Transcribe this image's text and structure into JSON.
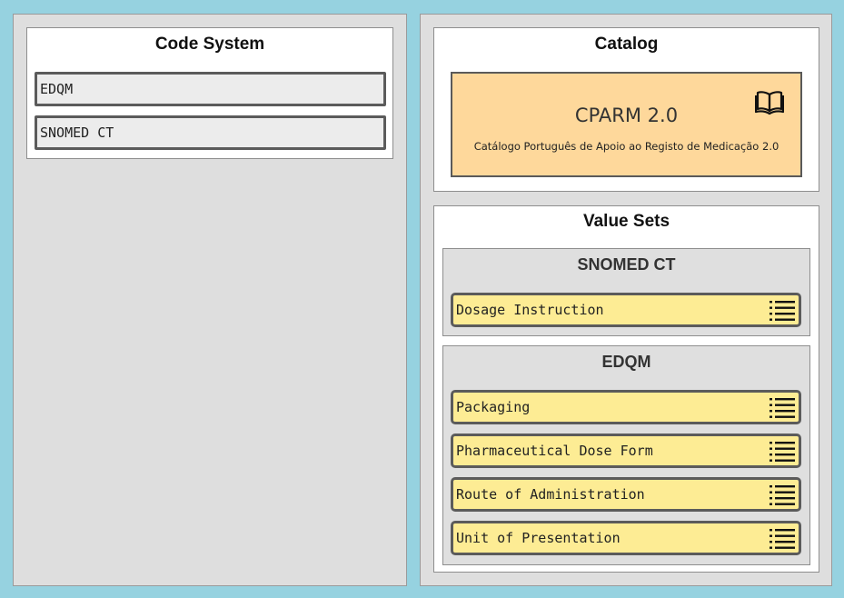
{
  "code_system": {
    "title": "Code System",
    "items": [
      {
        "label": "EDQM"
      },
      {
        "label": "SNOMED CT"
      }
    ]
  },
  "catalog": {
    "title": "Catalog",
    "name": "CPARM 2.0",
    "description": "Catálogo Português de Apoio ao Registo de Medicação 2.0",
    "icon": "book-icon"
  },
  "value_sets": {
    "title": "Value Sets",
    "groups": [
      {
        "title": "SNOMED CT",
        "items": [
          {
            "label": "Dosage Instruction",
            "icon": "list-icon"
          }
        ]
      },
      {
        "title": "EDQM",
        "items": [
          {
            "label": "Packaging",
            "icon": "list-icon"
          },
          {
            "label": "Pharmaceutical Dose Form",
            "icon": "list-icon"
          },
          {
            "label": "Route of Administration",
            "icon": "list-icon"
          },
          {
            "label": "Unit of Presentation",
            "icon": "list-icon"
          }
        ]
      }
    ]
  },
  "colors": {
    "background": "#96d2e0",
    "panel": "#dedede",
    "catalog_fill": "#fed89b",
    "value_set_fill": "#fdec94",
    "border": "#5b5b5b"
  }
}
